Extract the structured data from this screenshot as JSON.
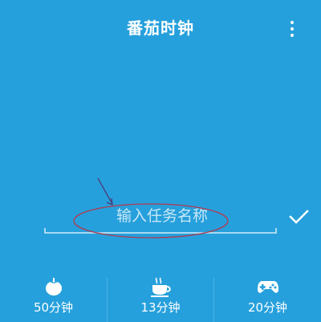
{
  "header": {
    "title": "番茄时钟",
    "menu_icon": "more-vertical-icon"
  },
  "task": {
    "placeholder": "输入任务名称",
    "value": "",
    "confirm_icon": "check-icon"
  },
  "presets": [
    {
      "label": "50分钟",
      "icon": "tomato-icon"
    },
    {
      "label": "13分钟",
      "icon": "coffee-cup-icon"
    },
    {
      "label": "20分钟",
      "icon": "gamepad-icon"
    }
  ],
  "colors": {
    "background": "#26a0dc",
    "text": "#ffffff",
    "annotation": "#b03a52"
  }
}
